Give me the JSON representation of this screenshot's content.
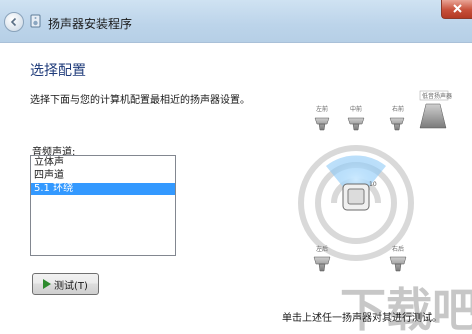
{
  "window": {
    "title": "扬声器安装程序"
  },
  "page": {
    "title": "选择配置",
    "description": "选择下面与您的计算机配置最相近的扬声器设置。"
  },
  "channels": {
    "label": "音频声道:",
    "items": [
      {
        "label": "立体声",
        "selected": false
      },
      {
        "label": "四声道",
        "selected": false
      },
      {
        "label": "5.1 环绕",
        "selected": true
      }
    ]
  },
  "test_button": {
    "label": "测试(T)"
  },
  "diagram": {
    "speakers": {
      "front_left": "左前",
      "front_center": "中前",
      "front_right": "右前",
      "subwoofer": "低音扬声器",
      "rear_left": "左后",
      "rear_right": "右后"
    }
  },
  "hint": "单击上述任一扬声器对其进行测试。",
  "watermark": {
    "text": "下载吧"
  }
}
